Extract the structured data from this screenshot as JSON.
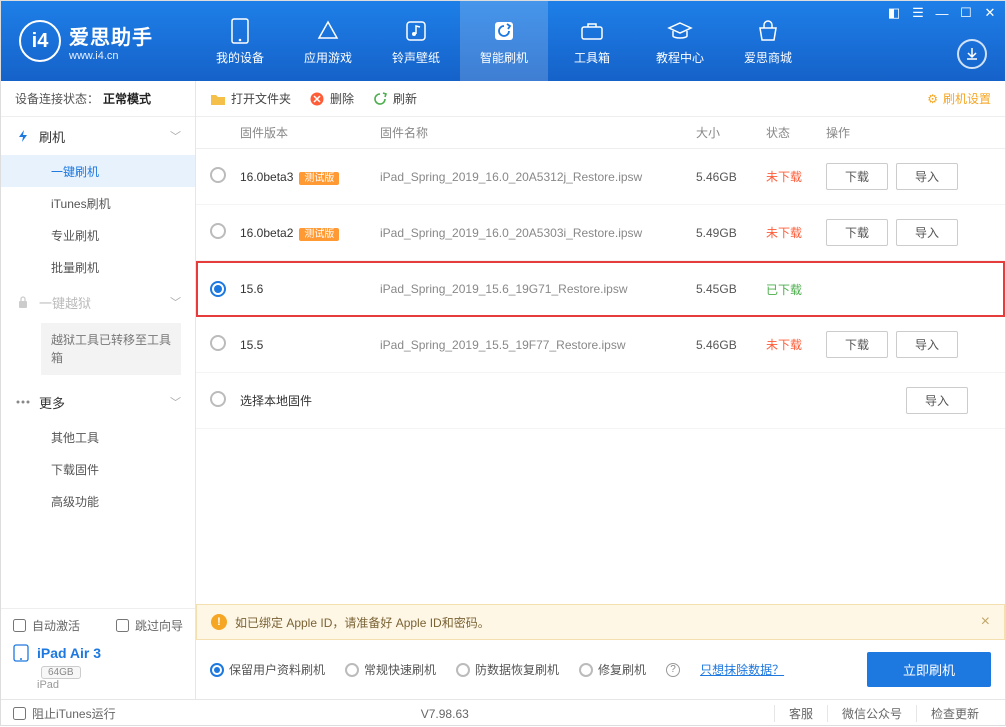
{
  "app": {
    "title": "爱思助手",
    "subtitle": "www.i4.cn"
  },
  "nav": {
    "tabs": [
      {
        "label": "我的设备"
      },
      {
        "label": "应用游戏"
      },
      {
        "label": "铃声壁纸"
      },
      {
        "label": "智能刷机"
      },
      {
        "label": "工具箱"
      },
      {
        "label": "教程中心"
      },
      {
        "label": "爱思商城"
      }
    ]
  },
  "sidebar": {
    "status_label": "设备连接状态：",
    "status_value": "正常模式",
    "groups": {
      "flash": {
        "label": "刷机"
      },
      "jailbreak": {
        "label": "一键越狱"
      },
      "more": {
        "label": "更多"
      }
    },
    "flash_items": [
      "一键刷机",
      "iTunes刷机",
      "专业刷机",
      "批量刷机"
    ],
    "jailbreak_note": "越狱工具已转移至工具箱",
    "more_items": [
      "其他工具",
      "下载固件",
      "高级功能"
    ],
    "auto_activate": "自动激活",
    "skip_wizard": "跳过向导",
    "device_name": "iPad Air 3",
    "device_capacity": "64GB",
    "device_type": "iPad"
  },
  "toolbar": {
    "open_folder": "打开文件夹",
    "delete": "删除",
    "refresh": "刷新",
    "settings": "刷机设置"
  },
  "columns": {
    "version": "固件版本",
    "name": "固件名称",
    "size": "大小",
    "status": "状态",
    "ops": "操作"
  },
  "rows": [
    {
      "selected": false,
      "version": "16.0beta3",
      "beta": "测试版",
      "name": "iPad_Spring_2019_16.0_20A5312j_Restore.ipsw",
      "size": "5.46GB",
      "status": "未下载",
      "downloaded": false,
      "show_ops": true
    },
    {
      "selected": false,
      "version": "16.0beta2",
      "beta": "测试版",
      "name": "iPad_Spring_2019_16.0_20A5303i_Restore.ipsw",
      "size": "5.49GB",
      "status": "未下载",
      "downloaded": false,
      "show_ops": true
    },
    {
      "selected": true,
      "version": "15.6",
      "beta": "",
      "name": "iPad_Spring_2019_15.6_19G71_Restore.ipsw",
      "size": "5.45GB",
      "status": "已下载",
      "downloaded": true,
      "show_ops": false
    },
    {
      "selected": false,
      "version": "15.5",
      "beta": "",
      "name": "iPad_Spring_2019_15.5_19F77_Restore.ipsw",
      "size": "5.46GB",
      "status": "未下载",
      "downloaded": false,
      "show_ops": true
    }
  ],
  "local_row": "选择本地固件",
  "buttons": {
    "download": "下载",
    "import": "导入"
  },
  "alert": "如已绑定 Apple ID，请准备好 Apple ID和密码。",
  "options": {
    "keep_data": "保留用户资料刷机",
    "normal": "常规快速刷机",
    "anti": "防数据恢复刷机",
    "repair": "修复刷机",
    "erase_link": "只想抹除数据？",
    "flash_now": "立即刷机"
  },
  "footer": {
    "block_itunes": "阻止iTunes运行",
    "version": "V7.98.63",
    "links": [
      "客服",
      "微信公众号",
      "检查更新"
    ]
  }
}
